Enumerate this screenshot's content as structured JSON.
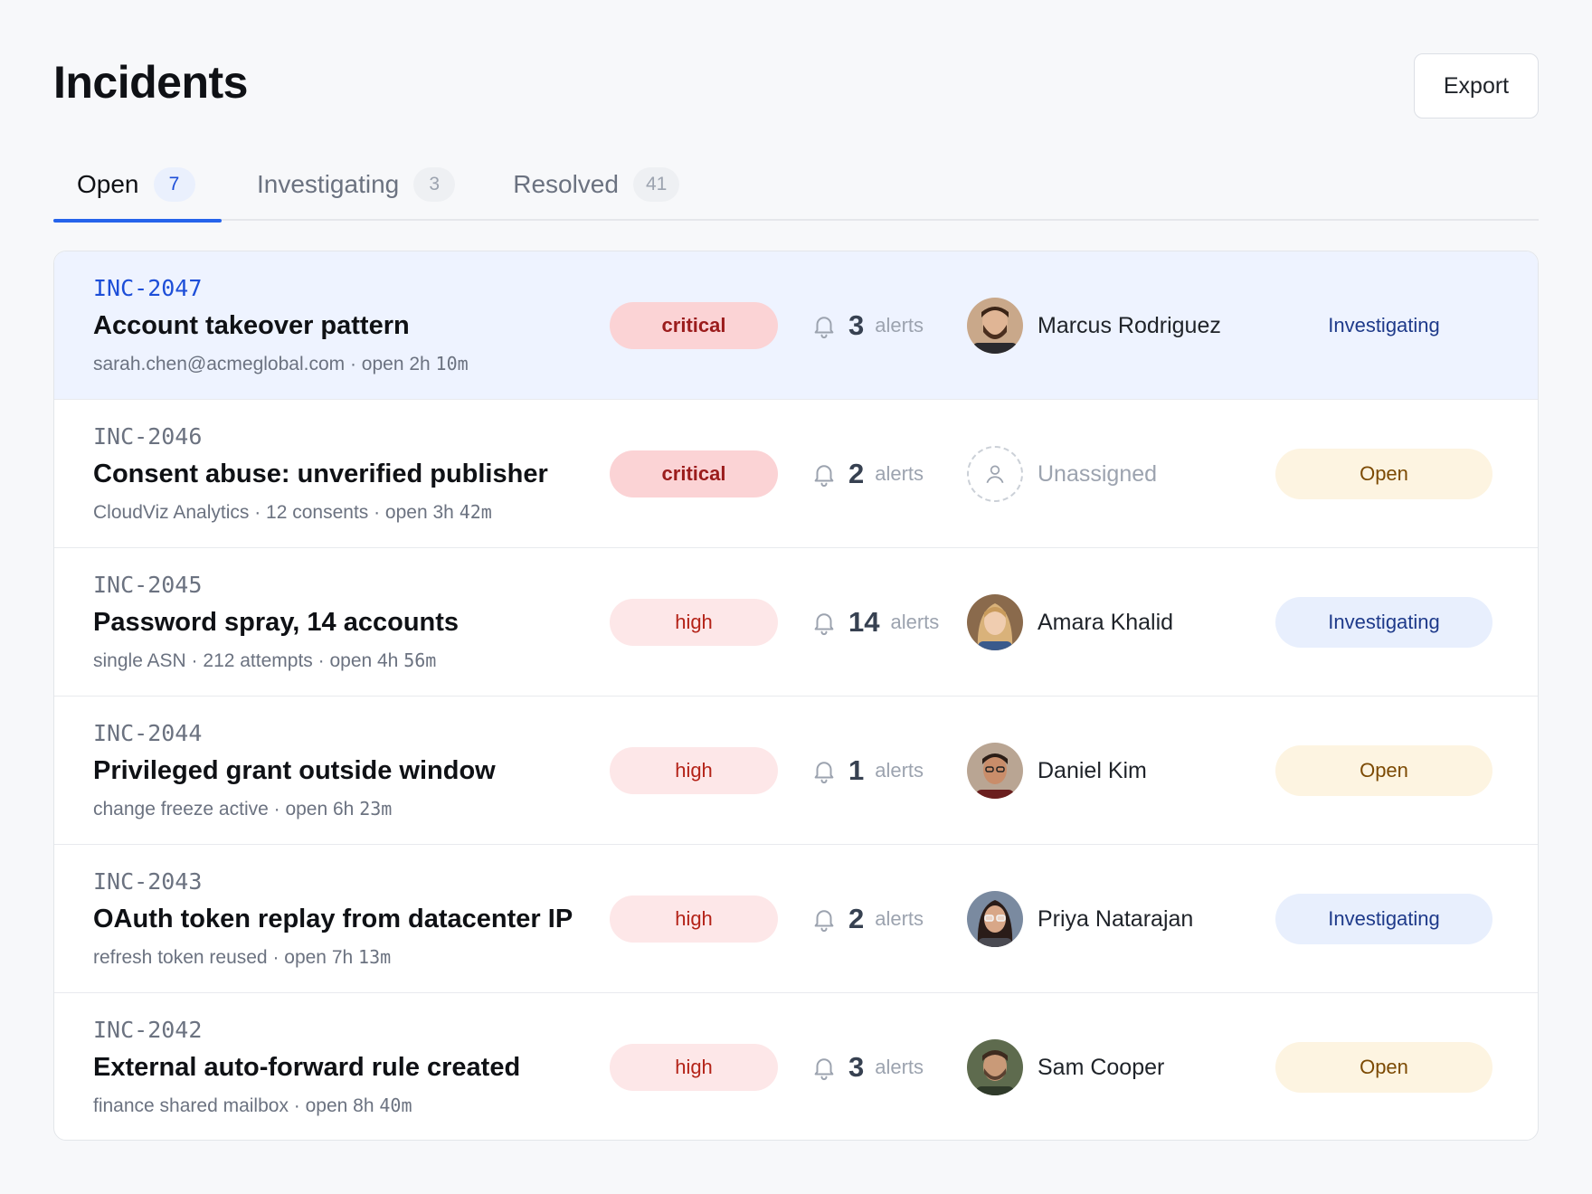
{
  "header": {
    "title": "Incidents",
    "export_label": "Export"
  },
  "tabs": [
    {
      "label": "Open",
      "count": "7",
      "active": true
    },
    {
      "label": "Investigating",
      "count": "3",
      "active": false
    },
    {
      "label": "Resolved",
      "count": "41",
      "active": false
    }
  ],
  "incidents": [
    {
      "id": "INC-2047",
      "title": "Account takeover pattern",
      "meta": "sarah.chen@acmeglobal.com · open 2h",
      "meta_mins": "10m",
      "severity": "critical",
      "alert_count": "3",
      "alert_word": "alerts",
      "assignee": "Marcus Rodriguez",
      "status": "Investigating",
      "selected": true
    },
    {
      "id": "INC-2046",
      "title": "Consent abuse: unverified publisher",
      "meta": "CloudViz Analytics · 12 consents · open 3h",
      "meta_mins": "42m",
      "severity": "critical",
      "alert_count": "2",
      "alert_word": "alerts",
      "assignee": "Unassigned",
      "status": "Open"
    },
    {
      "id": "INC-2045",
      "title": "Password spray, 14 accounts",
      "meta": "single ASN · 212 attempts · open 4h",
      "meta_mins": "56m",
      "severity": "high",
      "alert_count": "14",
      "alert_word": "alerts",
      "assignee": "Amara Khalid",
      "status": "Investigating"
    },
    {
      "id": "INC-2044",
      "title": "Privileged grant outside window",
      "meta": "change freeze active · open 6h",
      "meta_mins": "23m",
      "severity": "high",
      "alert_count": "1",
      "alert_word": "alerts",
      "assignee": "Daniel Kim",
      "status": "Open"
    },
    {
      "id": "INC-2043",
      "title": "OAuth token replay from datacenter IP",
      "meta": "refresh token reused · open 7h",
      "meta_mins": "13m",
      "severity": "high",
      "alert_count": "2",
      "alert_word": "alerts",
      "assignee": "Priya Natarajan",
      "status": "Investigating"
    },
    {
      "id": "INC-2042",
      "title": "External auto-forward rule created",
      "meta": "finance shared mailbox · open 8h",
      "meta_mins": "40m",
      "severity": "high",
      "alert_count": "3",
      "alert_word": "alerts",
      "assignee": "Sam Cooper",
      "status": "Open"
    }
  ],
  "icons": {
    "bell": "bell-icon",
    "avatar_placeholder": "user-icon"
  },
  "colors": {
    "accent": "#2563eb",
    "critical_bg": "#fbd3d5",
    "high_bg": "#fde7e8",
    "open_bg": "#fdf4e1",
    "investigating_bg": "#e8effd"
  }
}
